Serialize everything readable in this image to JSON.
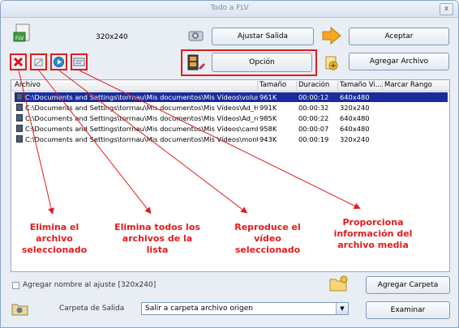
{
  "window": {
    "title": "Todo a FLV",
    "close_label": "x"
  },
  "toolbar": {
    "resolution": "320x240",
    "ajustar_salida": "Ajustar Salida",
    "aceptar": "Aceptar",
    "opcion": "Opción",
    "agregar_archivo": "Agregar Archivo",
    "flv_badge": "FLV"
  },
  "table": {
    "columns": [
      "Archivo",
      "Tamaño",
      "Duración",
      "Tamaño Vi...",
      "Marcar Rango"
    ],
    "rows": [
      [
        "C:\\Documents and Settings\\torrnau\\Mis documentos\\Mis Vídeos\\volumen_total.wmv",
        "961K",
        "00:00:12",
        "640x480",
        ""
      ],
      [
        "C:\\Documents and Settings\\torrnau\\Mis documentos\\Mis Vídeos\\Ad_HCl_rojo_metil...",
        "991K",
        "00:00:32",
        "320x240",
        ""
      ],
      [
        "C:\\Documents and Settings\\torrnau\\Mis documentos\\Mis Vídeos\\Ad_rojo_metilo.wmv",
        "985K",
        "00:00:22",
        "640x480",
        ""
      ],
      [
        "C:\\Documents and Settings\\torrnau\\Mis documentos\\Mis Vídeos\\cambio_color_rapi...",
        "958K",
        "00:00:07",
        "640x480",
        ""
      ],
      [
        "C:\\Documents and Settings\\torrnau\\Mis documentos\\Mis Vídeos\\montaje_bureta....",
        "943K",
        "00:00:19",
        "320x240",
        ""
      ]
    ]
  },
  "annotations": {
    "a1": "Elimina el archivo\nseleccionado",
    "a2": "Elimina todos los\narchivos de la lista",
    "a3": "Reproduce el vídeo\nseleccionado",
    "a4": "Proporciona\ninformación del\narchivo media"
  },
  "bottom": {
    "checkbox_label": "Agregar nombre al ajuste [320x240]",
    "agregar_carpeta": "Agregar Carpeta",
    "carpeta_label": "Carpeta de Salida",
    "carpeta_value": "Salir a carpeta archivo origen",
    "examinar": "Examinar"
  },
  "colors": {
    "accent_red": "#e31b1b",
    "selection": "#1a2c9c"
  }
}
